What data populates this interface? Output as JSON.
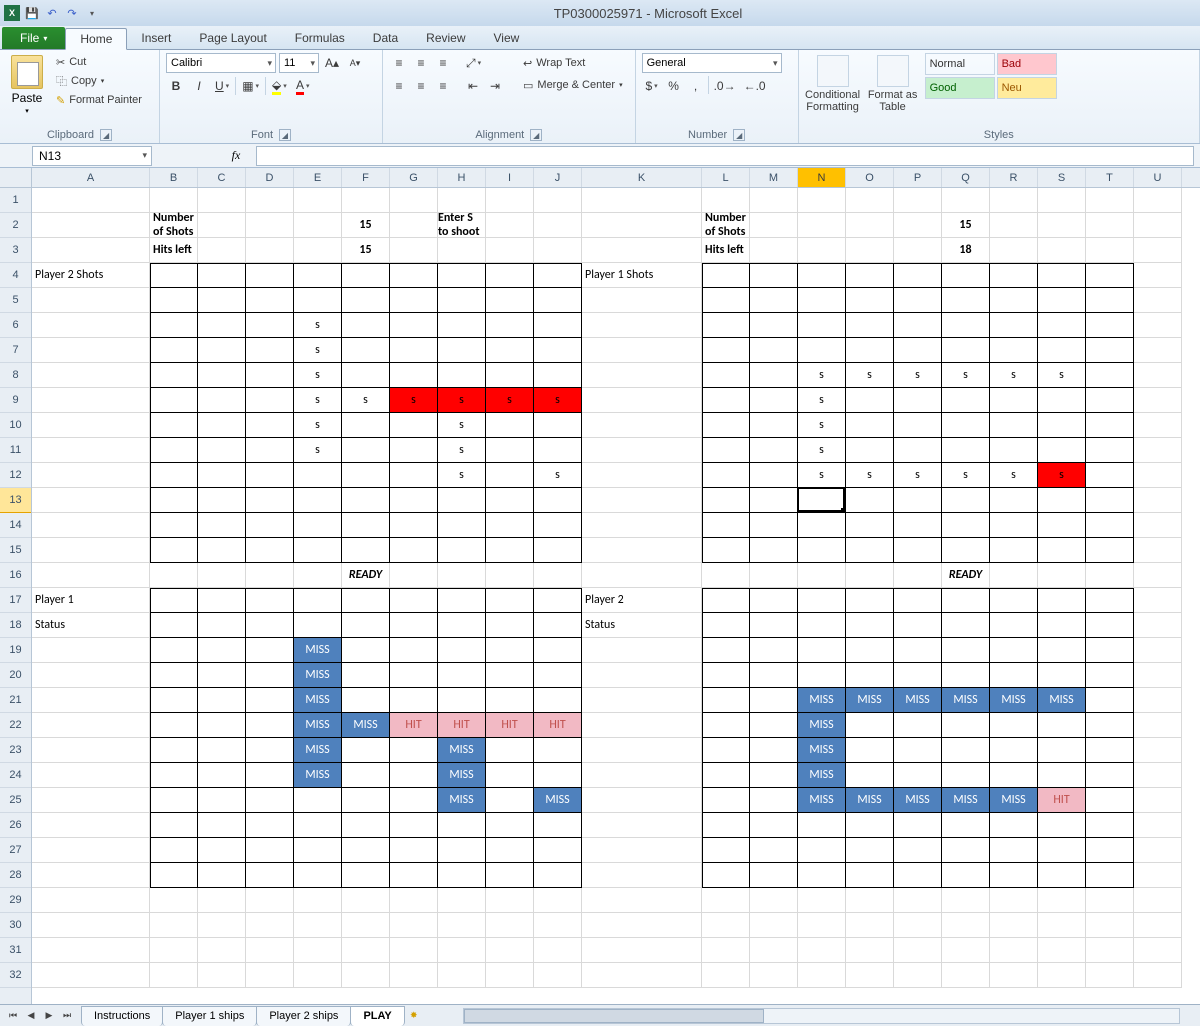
{
  "app": {
    "title": "TP0300025971 - Microsoft Excel"
  },
  "tabs": {
    "file": "File",
    "home": "Home",
    "insert": "Insert",
    "pagelayout": "Page Layout",
    "formulas": "Formulas",
    "data": "Data",
    "review": "Review",
    "view": "View"
  },
  "ribbon": {
    "clipboard": {
      "label": "Clipboard",
      "paste": "Paste",
      "cut": "Cut",
      "copy": "Copy",
      "formatpainter": "Format Painter"
    },
    "font": {
      "label": "Font",
      "name": "Calibri",
      "size": "11"
    },
    "alignment": {
      "label": "Alignment",
      "wrap": "Wrap Text",
      "merge": "Merge & Center"
    },
    "number": {
      "label": "Number",
      "format": "General"
    },
    "styles": {
      "label": "Styles",
      "conditional": "Conditional Formatting",
      "formatastable": "Format as Table",
      "normal": "Normal",
      "bad": "Bad",
      "good": "Good",
      "neutral": "Neu"
    }
  },
  "fx": {
    "namebox": "N13",
    "fx": "fx"
  },
  "columns": [
    "A",
    "B",
    "C",
    "D",
    "E",
    "F",
    "G",
    "H",
    "I",
    "J",
    "K",
    "L",
    "M",
    "N",
    "O",
    "P",
    "Q",
    "R",
    "S",
    "T",
    "U"
  ],
  "rows": [
    "1",
    "2",
    "3",
    "4",
    "5",
    "6",
    "7",
    "8",
    "9",
    "10",
    "11",
    "12",
    "13",
    "14",
    "15",
    "16",
    "17",
    "18",
    "19",
    "20",
    "21",
    "22",
    "23",
    "24",
    "25",
    "26",
    "27",
    "28",
    "29",
    "30",
    "31",
    "32"
  ],
  "sheet": {
    "labels": {
      "numshots": "Number of Shots",
      "hitsleft": "Hits left",
      "enterS": "Enter S to shoot",
      "p2shots": "Player 2 Shots",
      "p1shots": "Player 1 Shots",
      "ready": "READY",
      "p1": "Player 1",
      "p2": "Player 2",
      "status": "Status"
    },
    "vals": {
      "shots_l": "15",
      "hits_l": "15",
      "shots_r": "15",
      "hits_r": "18"
    },
    "s": "s",
    "miss": "MISS",
    "hit": "HIT"
  },
  "sheettabs": {
    "t1": "Instructions",
    "t2": "Player 1 ships",
    "t3": "Player 2 ships",
    "t4": "PLAY"
  },
  "activecell": {
    "row": 13,
    "col": "N"
  }
}
